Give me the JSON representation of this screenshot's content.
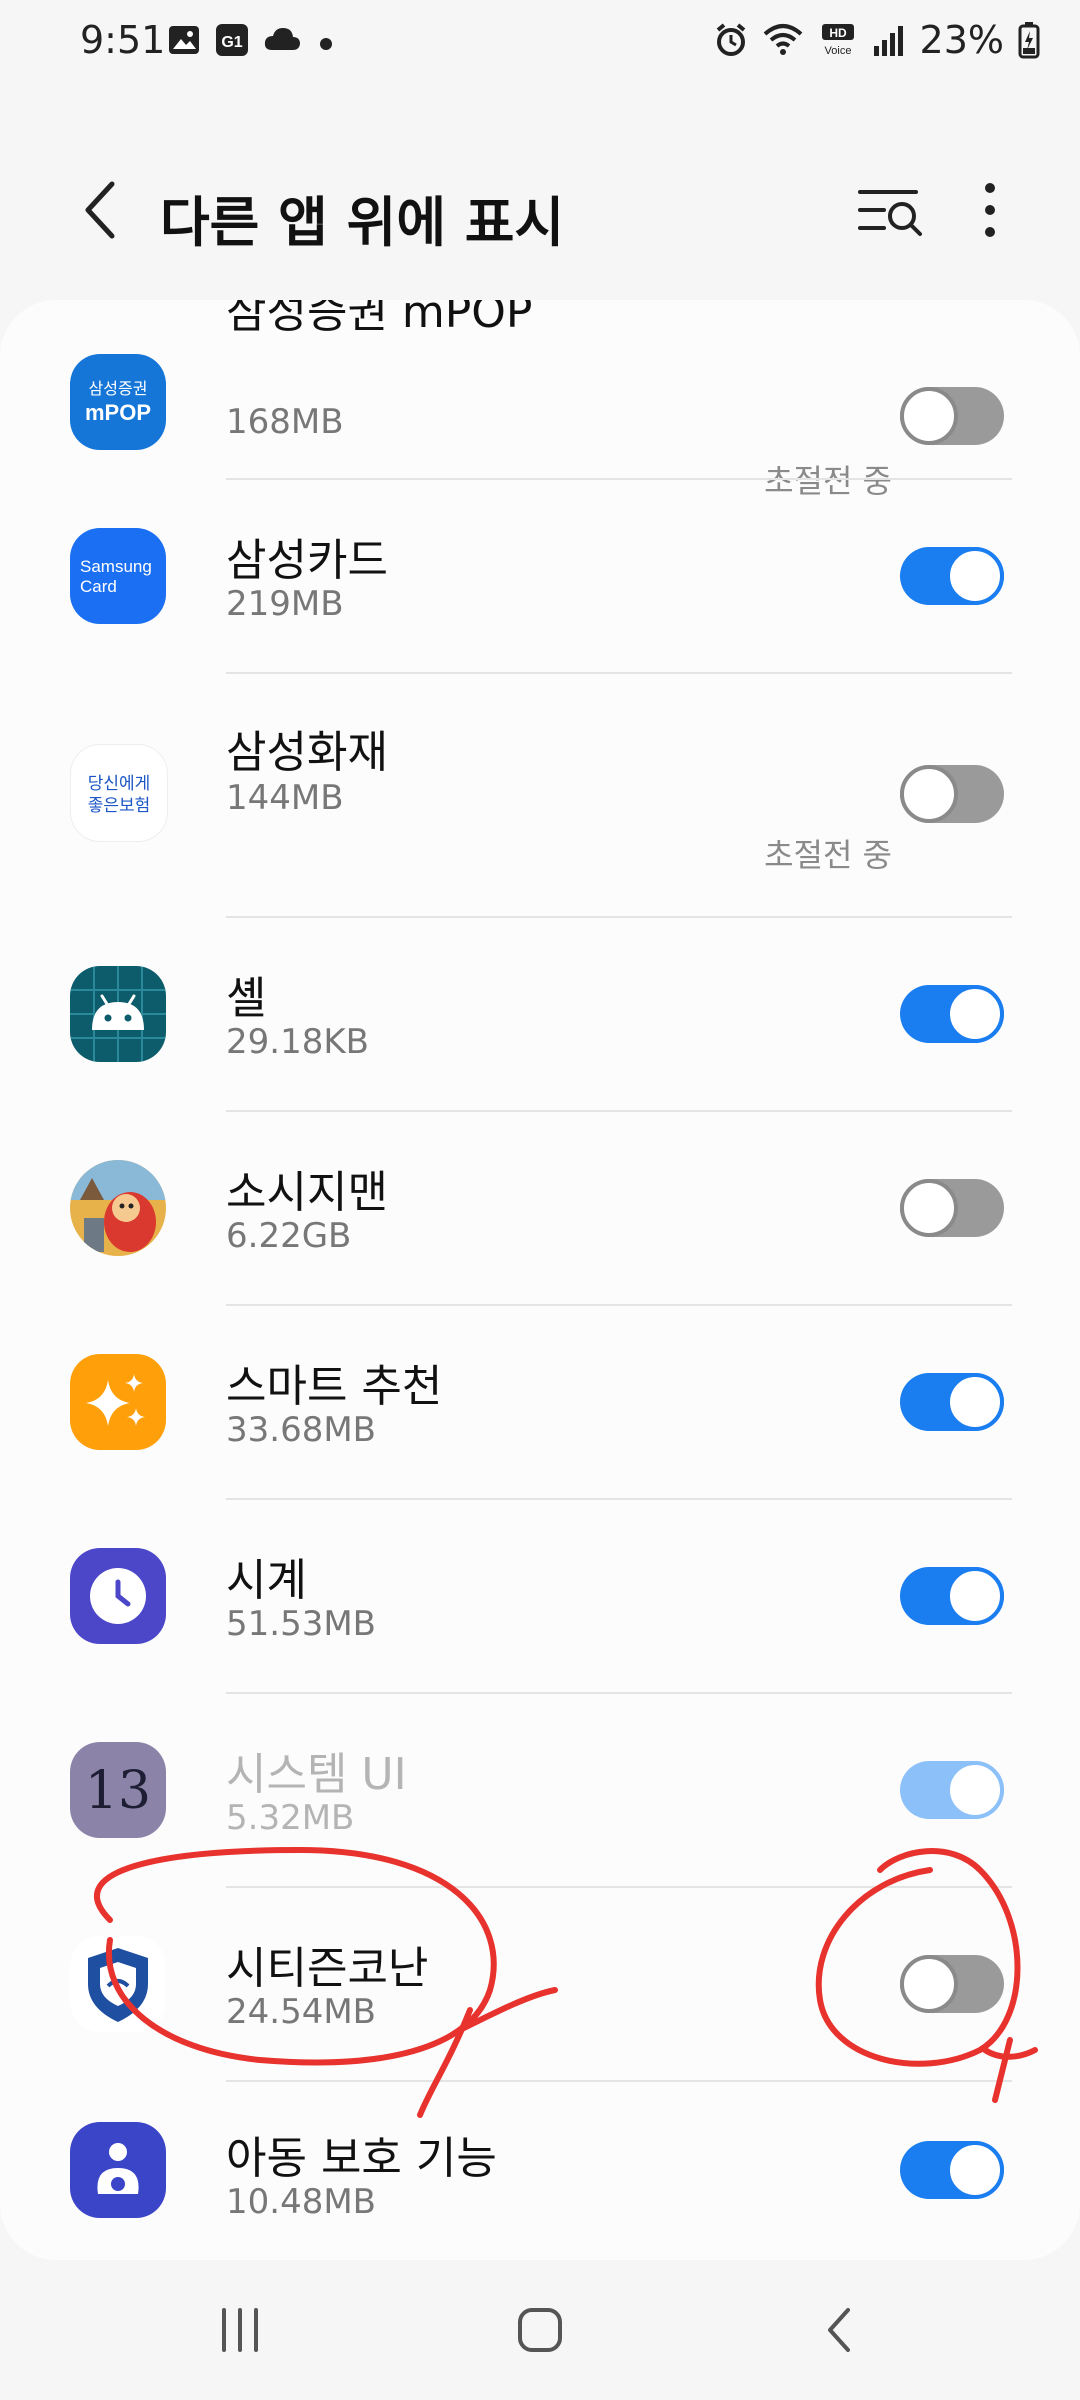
{
  "status_bar": {
    "time": "9:51",
    "battery": "23%"
  },
  "header": {
    "title": "다른 앱 위에 표시"
  },
  "apps": [
    {
      "name": "삼성증권 mPOP",
      "size": "168MB",
      "note": "초절전 중",
      "enabled": false,
      "icon_text": "삼성증권 mPOP",
      "icon_color": "#1576d8"
    },
    {
      "name": "삼성카드",
      "size": "219MB",
      "note": "",
      "enabled": true,
      "icon_text": "Samsung Card",
      "icon_color": "#1a6ff2"
    },
    {
      "name": "삼성화재",
      "size": "144MB",
      "note": "초절전 중",
      "enabled": false,
      "icon_text": "당신에게 좋은보험",
      "icon_color": "#ffffff"
    },
    {
      "name": "셸",
      "size": "29.18KB",
      "note": "",
      "enabled": true,
      "icon_text": "",
      "icon_color": "#0d5c6b"
    },
    {
      "name": "소시지맨",
      "size": "6.22GB",
      "note": "",
      "enabled": false,
      "icon_text": "",
      "icon_color": "#e8b24a"
    },
    {
      "name": "스마트 추천",
      "size": "33.68MB",
      "note": "",
      "enabled": true,
      "icon_text": "",
      "icon_color": "#ff9f0a"
    },
    {
      "name": "시계",
      "size": "51.53MB",
      "note": "",
      "enabled": true,
      "icon_text": "",
      "icon_color": "#4b47c8"
    },
    {
      "name": "시스템 UI",
      "size": "5.32MB",
      "note": "",
      "enabled": true,
      "disabled": true,
      "icon_text": "13",
      "icon_color": "#8b83a8"
    },
    {
      "name": "시티즌코난",
      "size": "24.54MB",
      "note": "",
      "enabled": false,
      "icon_text": "",
      "icon_color": "#1f4fa0"
    },
    {
      "name": "아동 보호 기능",
      "size": "10.48MB",
      "note": "",
      "enabled": true,
      "icon_text": "",
      "icon_color": "#3a45c7"
    }
  ],
  "icons": [
    "image-icon",
    "g1-icon",
    "cloud-icon",
    "alarm-icon",
    "wifi-icon",
    "hd-voice-icon",
    "signal-icon",
    "battery-icon",
    "back-icon",
    "search-list-icon",
    "more-icon"
  ],
  "annotation_color": "#e8322d"
}
